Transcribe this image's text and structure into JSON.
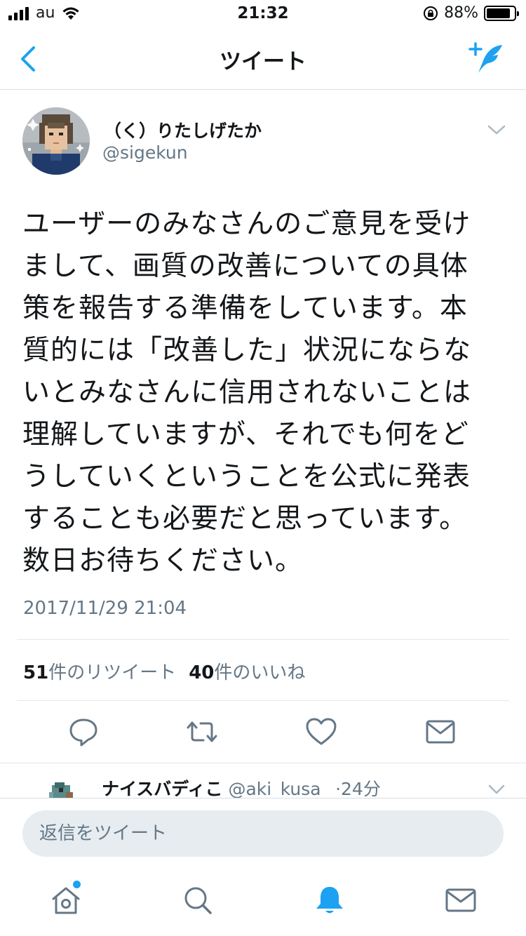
{
  "status_bar": {
    "carrier": "au",
    "time": "21:32",
    "battery_percent_label": "88%",
    "battery_level": 0.88
  },
  "nav": {
    "title": "ツイート",
    "back_icon": "chevron-left-icon",
    "compose_icon": "compose-tweet-icon",
    "accent_color": "#1da1f2"
  },
  "tweet": {
    "author_name": "（く）りたしげたか",
    "author_handle": "@sigekun",
    "text": "ユーザーのみなさんのご意見を受け\nまして、画質の改善についての具体\n策を報告する準備をしています。本\n質的には「改善した」状況にならな\nいとみなさんに信用されないことは\n理解していますが、それでも何をど\nうしていくということを公式に発表\nすることも必要だと思っています。\n数日お待ちください。",
    "timestamp": "2017/11/29 21:04",
    "retweet_count": "51",
    "retweet_label": "件のリツイート",
    "like_count": "40",
    "like_label": "件のいいね"
  },
  "reply_preview": {
    "name": "ナイスバディこ",
    "handle": "@aki_kusa_",
    "separator": "·",
    "age": "24分"
  },
  "composer": {
    "placeholder": "返信をツイート"
  },
  "tabs": [
    {
      "icon": "home-icon",
      "active": false,
      "has_notification_dot": true
    },
    {
      "icon": "search-icon",
      "active": false
    },
    {
      "icon": "notifications-bell-icon",
      "active": true
    },
    {
      "icon": "messages-envelope-icon",
      "active": false
    }
  ],
  "colors": {
    "text_primary": "#14171a",
    "text_secondary": "#657786",
    "icon_gray": "#657786",
    "divider": "#e1e8ed",
    "input_bg": "#e6ecf0",
    "accent": "#1da1f2"
  }
}
